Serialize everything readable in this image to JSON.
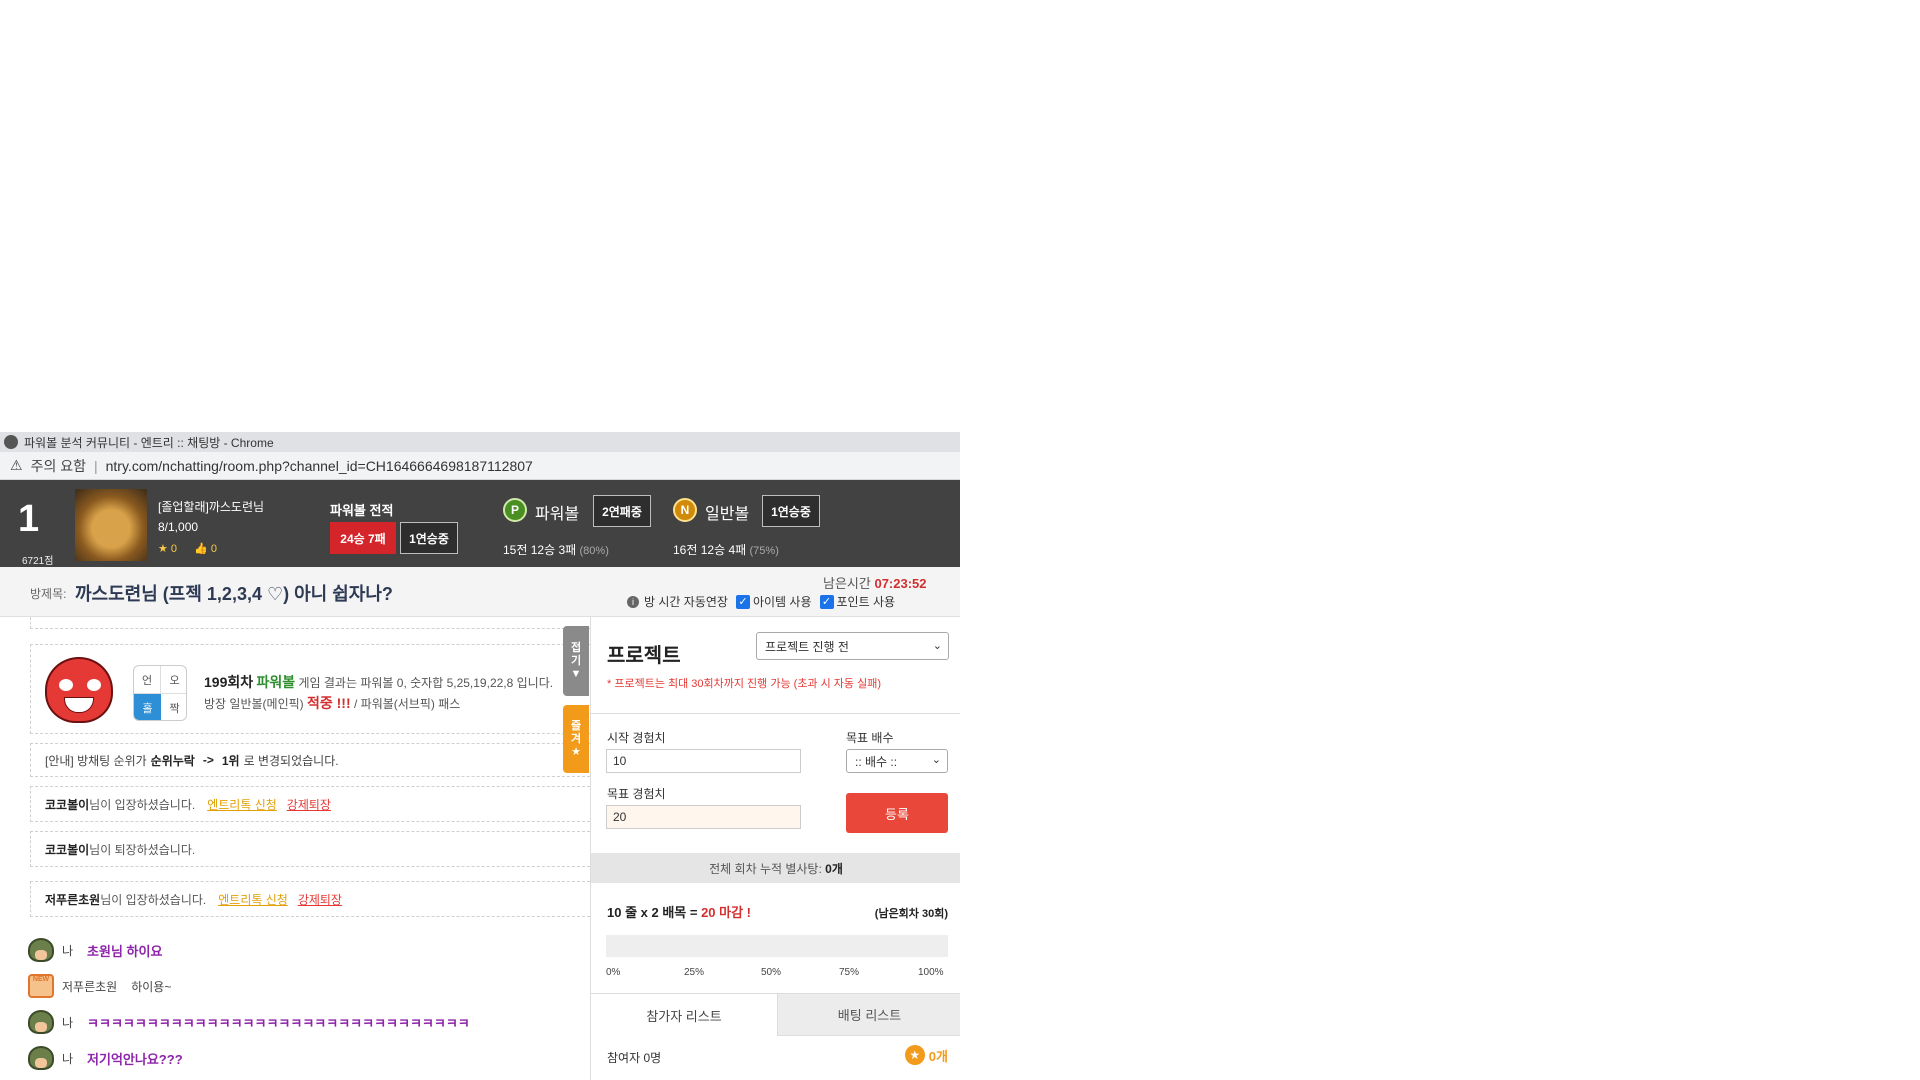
{
  "window": {
    "title": "파워볼 분석 커뮤니티 - 엔트리 :: 채팅방 - Chrome",
    "warning": "주의 요함",
    "url": "ntry.com/nchatting/room.php?channel_id=CH1646664698187112807"
  },
  "header": {
    "rank": "1",
    "rank_points": "6721점",
    "user_name": "[졸업할래]까스도련님",
    "level": "8/1,000",
    "stars": "★ 0",
    "likes": "👍 0",
    "record_title": "파워볼 전적",
    "record_winloss": "24승 7패",
    "record_streak": "1연승중",
    "powerball": {
      "icon": "P",
      "name": "파워볼",
      "streak": "2연패중",
      "record": "15전 12승 3패",
      "pct": "(80%)"
    },
    "normalball": {
      "icon": "N",
      "name": "일반볼",
      "streak": "1연승중",
      "record": "16전 12승 4패",
      "pct": "(75%)"
    }
  },
  "room": {
    "label": "방제목:",
    "title": "까스도련님 (프젝 1,2,3,4 ♡) 아니 쉽자나?",
    "remain_label": "남은시간",
    "remain_time": "07:23:52",
    "auto_extend": "방 시간 자동연장",
    "item_use": "아이템 사용",
    "point_use": "포인트 사용"
  },
  "chat": {
    "fold_tab": [
      "접",
      "기",
      "▼"
    ],
    "fav_tab": [
      "즐",
      "겨",
      "★"
    ],
    "game_grid": {
      "tl": "언",
      "tr": "오",
      "bl": "홀",
      "br": "짝"
    },
    "game_round": "199회차",
    "game_ball": "파워볼",
    "game_text1": "게임 결과는 파워볼 0, 숫자합 5,25,19,22,8 입니다.",
    "game_text2a": "방장 일반볼(메인픽)",
    "game_hit": "적중 !!!",
    "game_text2b": "/ 파워볼(서브픽) 패스",
    "notice_prefix": "[안내] 방채팅 순위가",
    "notice_from": "순위누락",
    "notice_arrow": "->",
    "notice_to": "1위",
    "notice_suffix": "로 변경되었습니다.",
    "entries": [
      {
        "name": "코코볼이",
        "text": "님이 입장하셨습니다.",
        "link1": "엔트리톡 신청",
        "link2": "강제퇴장"
      },
      {
        "name": "코코볼이",
        "text": "님이 퇴장하셨습니다.",
        "link1": "",
        "link2": ""
      },
      {
        "name": "저푸른초원",
        "text": "님이 입장하셨습니다.",
        "link1": "엔트리톡 신청",
        "link2": "강제퇴장"
      }
    ],
    "lines": [
      {
        "who": "나",
        "text": "초원님 하이요"
      },
      {
        "who": "저푸른초원",
        "text": "하이용~"
      },
      {
        "who": "나",
        "text": "ㅋㅋㅋㅋㅋㅋㅋㅋㅋㅋㅋㅋㅋㅋㅋㅋㅋㅋㅋㅋㅋㅋㅋㅋㅋㅋㅋㅋㅋㅋㅋㅋ"
      },
      {
        "who": "나",
        "text": "저기억안나요???"
      }
    ]
  },
  "project": {
    "title": "프로젝트",
    "status_select": "프로젝트 진행 전",
    "note": "* 프로젝트는 최대 30회차까지 진행 가능 (초과 시 자동 실패)",
    "start_label": "시작 경험치",
    "start_value": "10",
    "multiplier_label": "목표 배수",
    "multiplier_select": ":: 배수 ::",
    "target_label": "목표 경험치",
    "target_value": "20",
    "register": "등록",
    "cumulative": "전체 회차 누적 별사탕:",
    "cumulative_value": "0개",
    "calc_a": "10 줄 x 2 배목 =",
    "calc_b": "20 마감 !",
    "remaining": "(남은회차 30회)",
    "progress": 0,
    "ticks": [
      "0%",
      "25%",
      "50%",
      "75%",
      "100%"
    ],
    "tab_participants": "참가자 리스트",
    "tab_betting": "배팅 리스트",
    "participants": "참여자 0명",
    "points": "0개"
  }
}
